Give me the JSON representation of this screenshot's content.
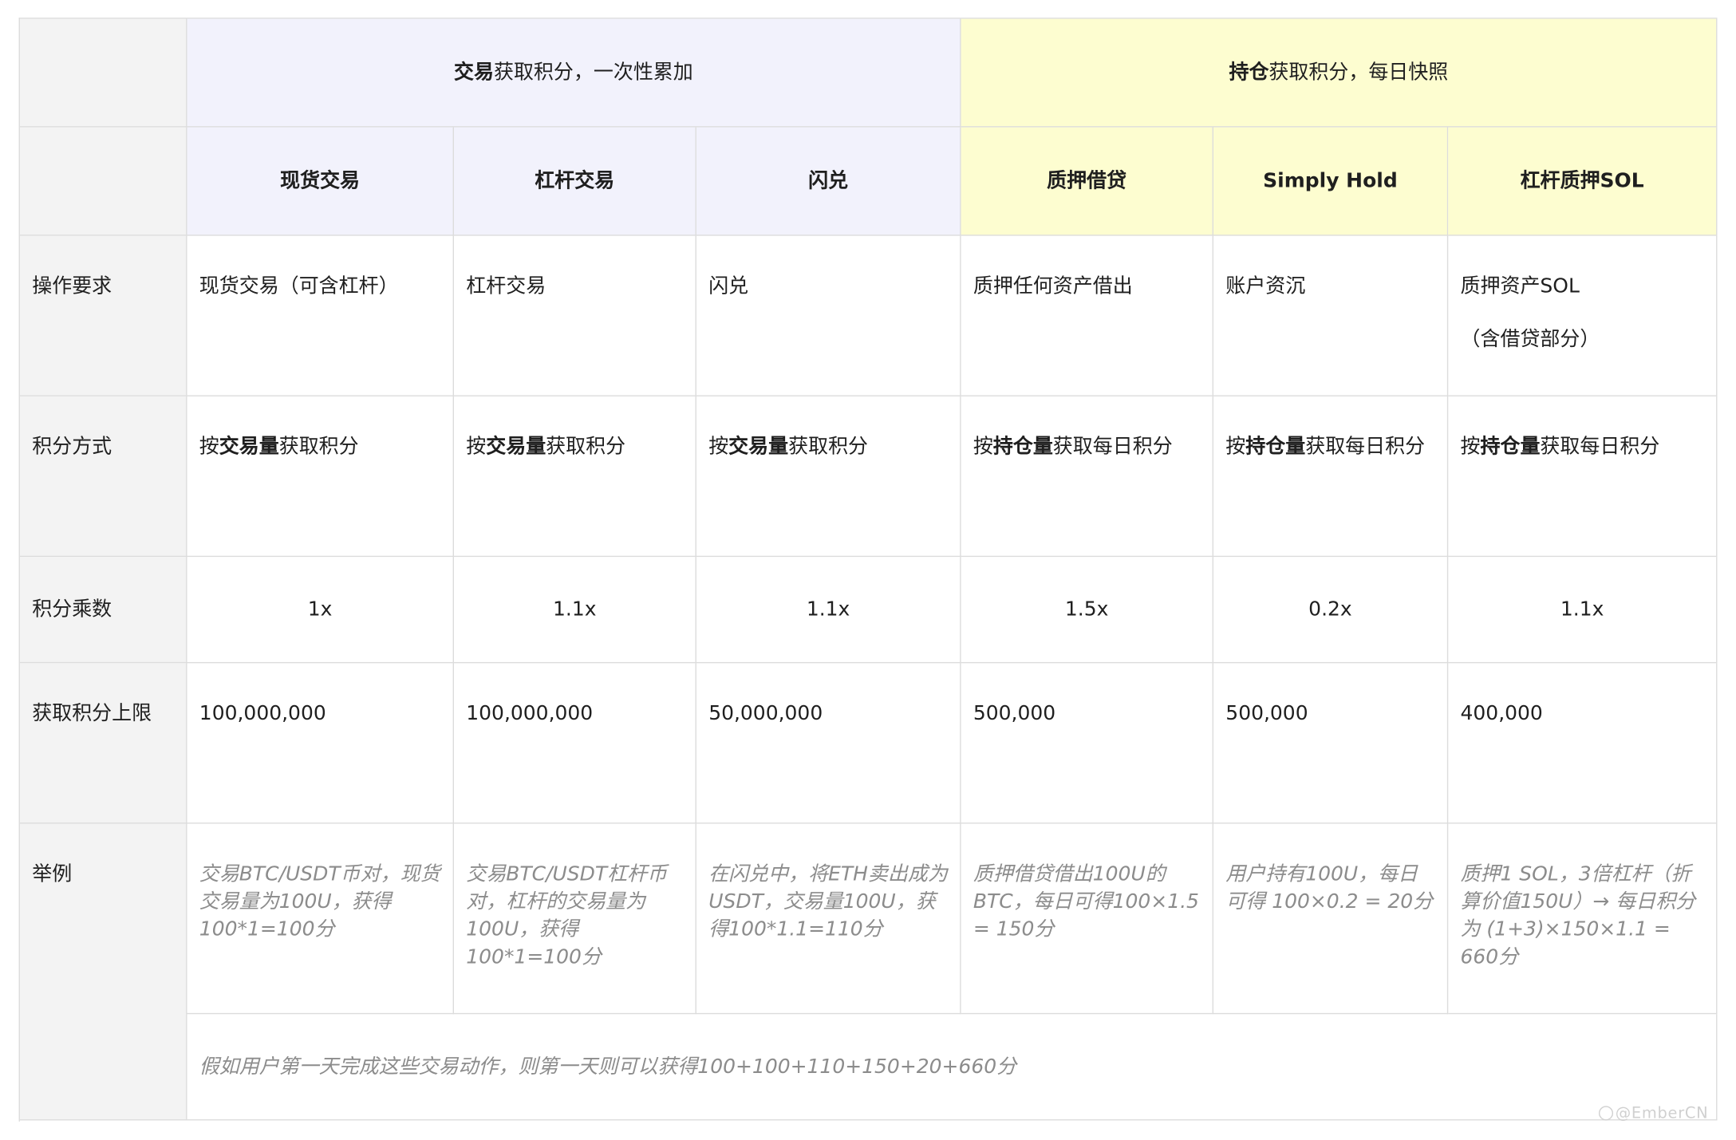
{
  "groups": {
    "trade": "交易获取积分，一次性累加",
    "hold": "持仓获取积分，每日快照"
  },
  "columns": [
    "现货交易",
    "杠杆交易",
    "闪兑",
    "质押借贷",
    "Simply Hold",
    "杠杆质押SOL"
  ],
  "rows": [
    {
      "label": "操作要求",
      "cells": [
        "现货交易（可含杠杆）",
        "杠杆交易",
        "闪兑",
        "质押任何资产借出",
        "账户资沉",
        "质押资产SOL"
      ],
      "extra": "（含借贷部分）"
    },
    {
      "label": "积分方式",
      "cells": [
        [
          "按",
          "交易量",
          "获取积分"
        ],
        [
          "按",
          "交易量",
          "获取积分"
        ],
        [
          "按",
          "交易量",
          "获取积分"
        ],
        [
          "按",
          "持仓量",
          "获取每日积分"
        ],
        [
          "按",
          "持仓量",
          "获取每日积分"
        ],
        [
          "按",
          "持仓量",
          "获取每日积分"
        ]
      ]
    },
    {
      "label": "积分乘数",
      "cells": [
        "1x",
        "1.1x",
        "1.1x",
        "1.5x",
        "0.2x",
        "1.1x"
      ]
    },
    {
      "label": "获取积分上限",
      "cells": [
        "100,000,000",
        "100,000,000",
        "50,000,000",
        "500,000",
        "500,000",
        "400,000"
      ]
    },
    {
      "label": "举例",
      "cells": [
        "交易BTC/USDT币对，现货交易量为100U，获得100*1=100分",
        "交易BTC/USDT杠杆币对，杠杆的交易量为100U，获得100*1=100分",
        "在闪兑中，将ETH卖出成为USDT，交易量100U，获得100*1.1=110分",
        "质押借贷借出100U的BTC，每日可得100×1.5 = 150分",
        "用户持有100U，每日可得 100×0.2 = 20分",
        "质押1 SOL，3倍杠杆（折算价值150U）→ 每日积分为 (1+3)×150×1.1 = 660分"
      ],
      "note": "假如用户第一天完成这些交易动作，则第一天则可以获得100+100+110+150+20+660分"
    }
  ],
  "watermark": "@EmberCN",
  "colors": {
    "trade_group_bg": "#f2f2fc",
    "hold_group_bg": "#fdfdd0",
    "row_header_bg": "#f3f3f3",
    "example_text": "#8c8c8c",
    "border": "#dcdcdc"
  }
}
